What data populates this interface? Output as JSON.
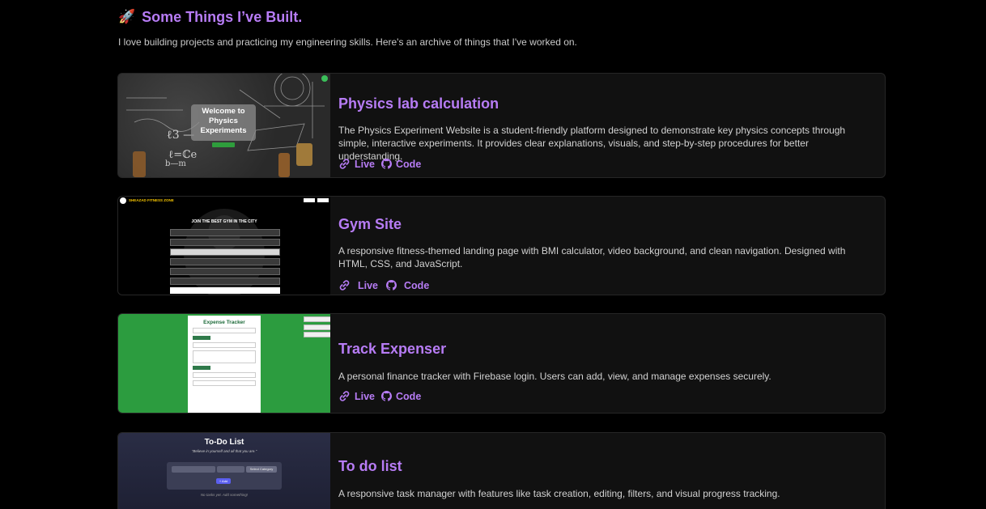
{
  "section": {
    "icon": "rocket-icon",
    "title": "Some Things I’ve Built.",
    "subtitle": "I love building projects and practicing my engineering skills. Here's an archive of things that I've worked on."
  },
  "projects": [
    {
      "title": "Physics lab calculation",
      "description": "The Physics Experiment Website is a student-friendly platform designed to demonstrate key physics concepts through simple, interactive experiments. It provides clear explanations, visuals, and step-by-step procedures for better understanding.",
      "live_label": "Live",
      "code_label": "Code",
      "thumb": {
        "welcome": "Welcome to Physics Experiments"
      }
    },
    {
      "title": "Gym Site",
      "description": "A responsive fitness-themed landing page with BMI calculator, video background, and clean navigation. Designed with HTML, CSS, and JavaScript.",
      "live_label": "Live",
      "code_label": "Code",
      "thumb": {
        "brand": "SHEAZAD FITNESS ZONE",
        "headline": "JOIN THE BEST GYM IN THE CITY"
      }
    },
    {
      "title": "Track Expenser",
      "description": "A personal finance tracker with Firebase login. Users can add, view, and manage expenses securely.",
      "live_label": "Live",
      "code_label": "Code",
      "thumb": {
        "title": "Expense Tracker"
      }
    },
    {
      "title": "To do list",
      "description": "A responsive task manager with features like task creation, editing, filters, and visual progress tracking.",
      "live_label": "Live",
      "code_label": "Code",
      "thumb": {
        "title": "To-Do List",
        "quote": "\"Believe in yourself and all that you are.\"",
        "category": "Select Category",
        "add": "+ Add",
        "empty": "No tasks yet. Add something!"
      }
    }
  ],
  "colors": {
    "accent": "#b77cf5",
    "background": "#000000",
    "card": "#111111"
  }
}
